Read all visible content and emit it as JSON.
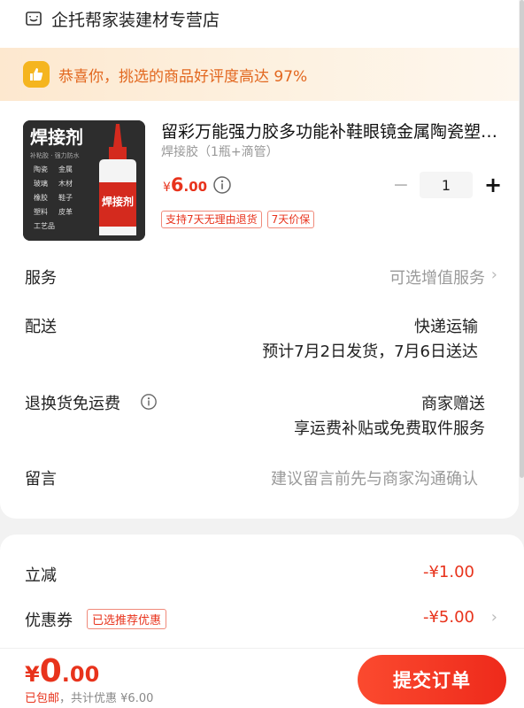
{
  "shop": {
    "name": "企托帮家装建材专营店",
    "icon": "shop-icon"
  },
  "banner": {
    "icon": "thumbs-up-icon",
    "text": "恭喜你，挑选的商品好评度高达 97%"
  },
  "product": {
    "title": "留彩万能强力胶多功能补鞋眼镜金属陶瓷塑料玻璃木材强力胶水",
    "spec": "焊接胶（1瓶+滴管）",
    "price_currency": "¥",
    "price_integer": "6",
    "price_decimal": ".00",
    "quantity": "1",
    "tags": [
      "支持7天无理由退货",
      "7天价保"
    ],
    "image": {
      "title": "焊接剂",
      "subtitle": "补粘胶 · 强力防水",
      "features": [
        "陶瓷",
        "金属",
        "玻璃",
        "木材",
        "橡胶",
        "鞋子",
        "塑料",
        "皮革",
        "工艺品"
      ],
      "bottle_label": "焊接剂"
    }
  },
  "service": {
    "label": "服务",
    "value": "可选增值服务"
  },
  "delivery": {
    "label": "配送",
    "method": "快递运输",
    "eta": "预计7月2日发货，7月6日送达"
  },
  "return_shipping": {
    "label": "退换货免运费",
    "value": "商家赠送",
    "detail": "享运费补贴或免费取件服务"
  },
  "message": {
    "label": "留言",
    "placeholder": "建议留言前先与商家沟通确认"
  },
  "discounts": {
    "instant_label": "立减",
    "instant_value": "-¥1.00",
    "coupon_label": "优惠券",
    "coupon_badge": "已选推荐优惠",
    "coupon_value": "-¥5.00"
  },
  "checkout": {
    "total_currency": "¥",
    "total_integer": "0",
    "total_decimal": ".00",
    "shipping_note": "已包邮",
    "savings_note": "，共计优惠 ¥6.00",
    "submit_label": "提交订单"
  },
  "colors": {
    "accent": "#e8331c",
    "banner_text": "#e2671f",
    "badge_yellow": "#f5b51f"
  }
}
